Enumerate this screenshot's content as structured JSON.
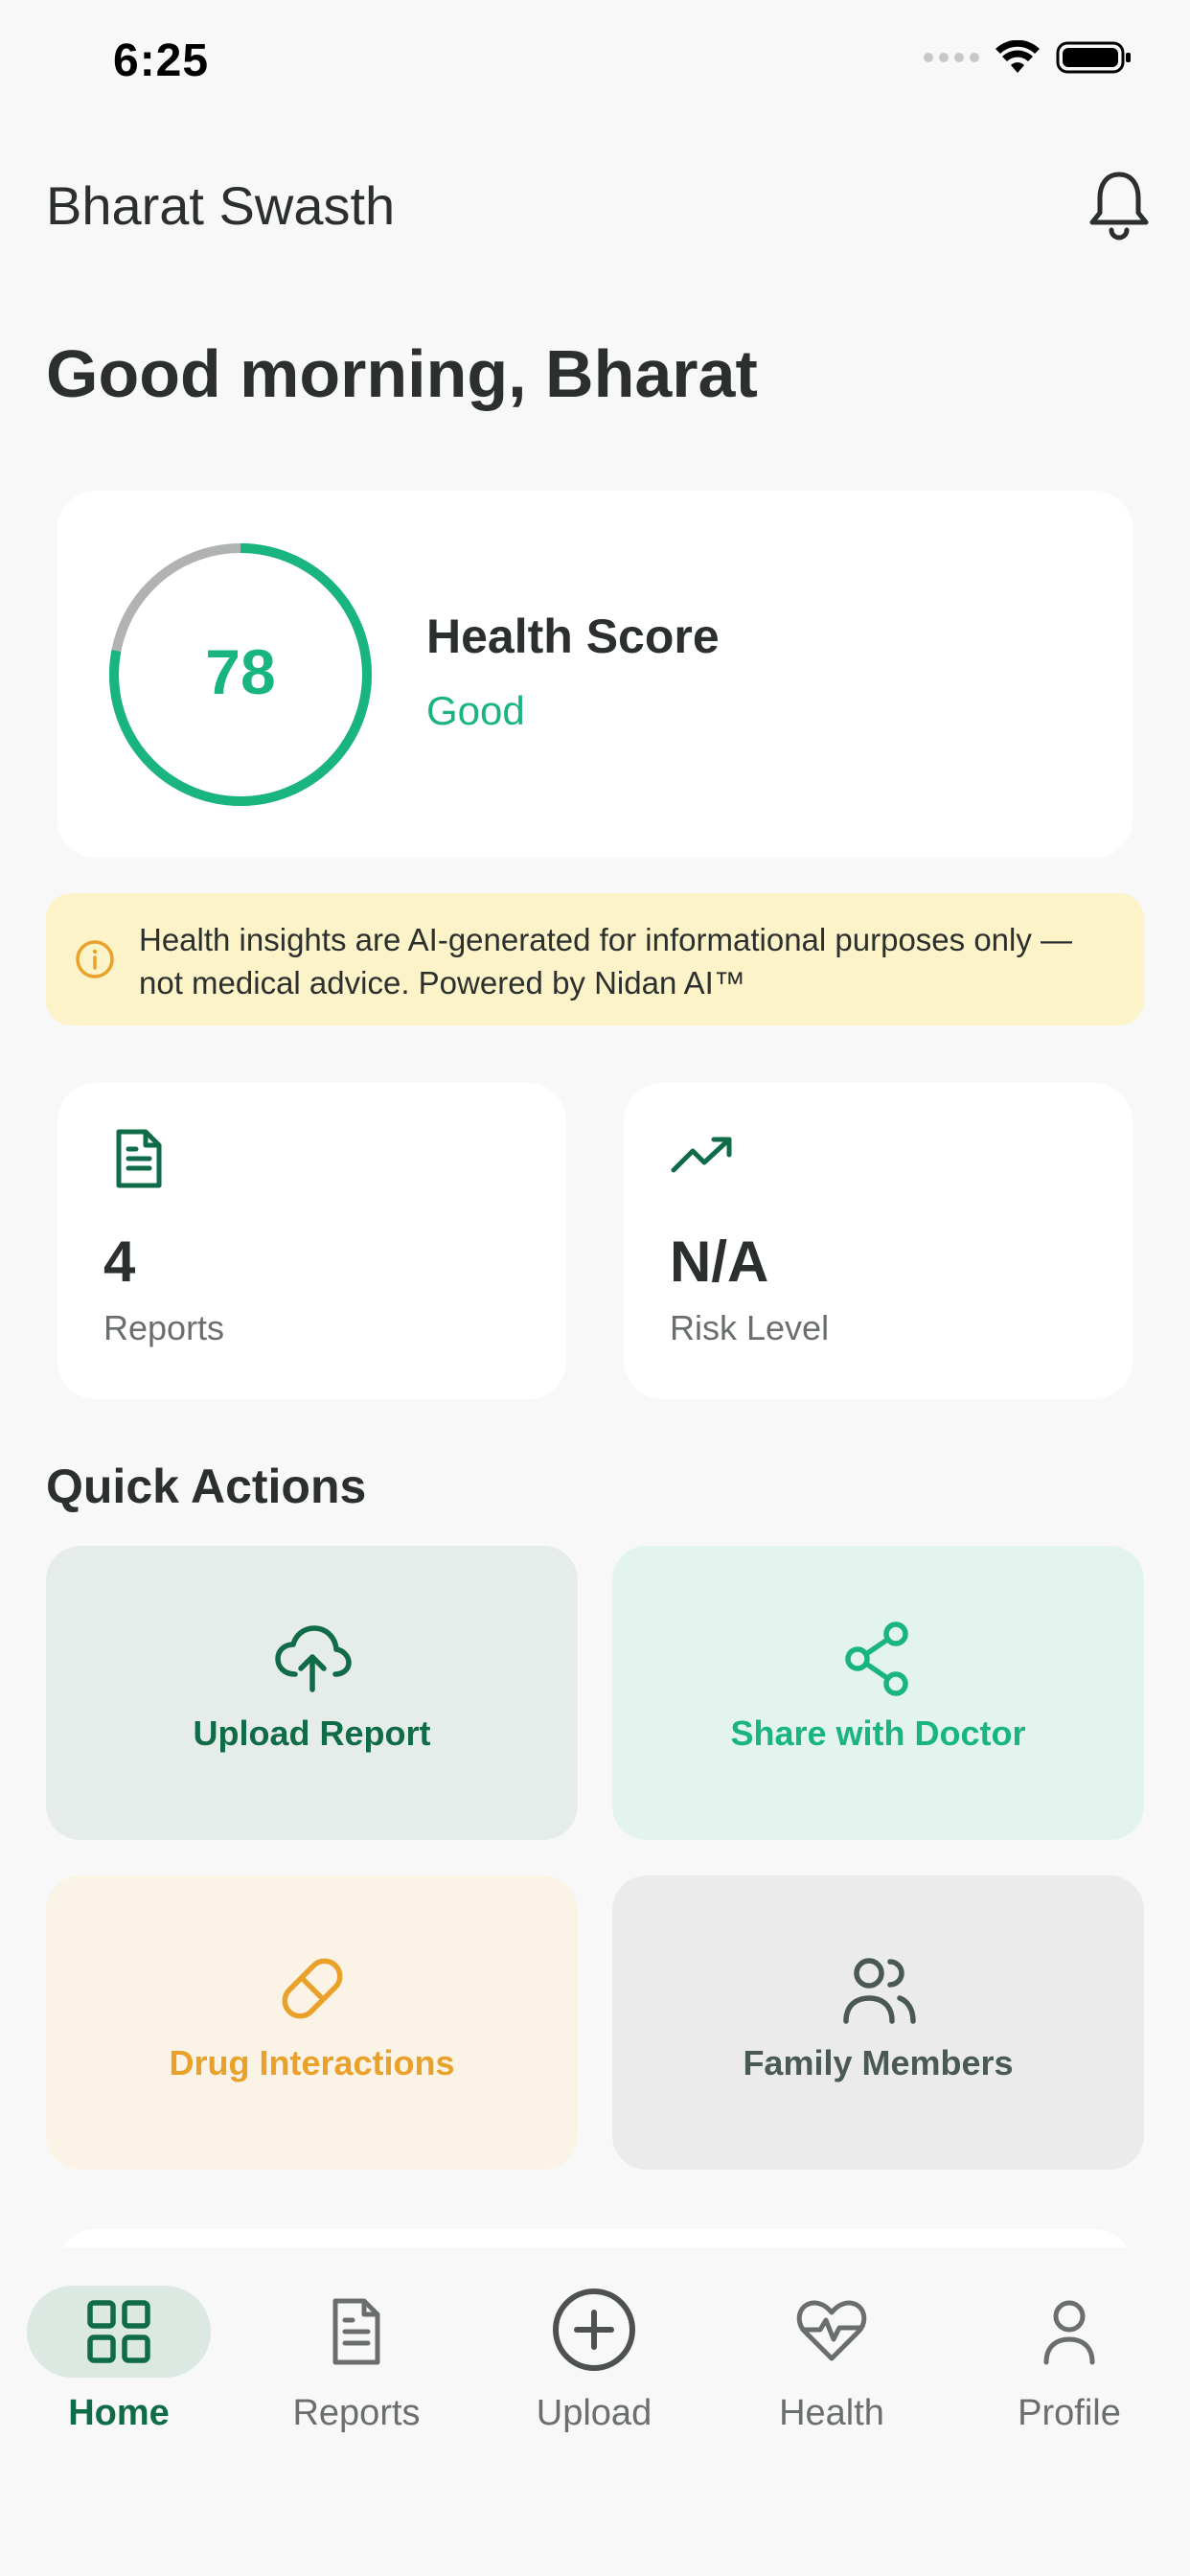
{
  "status_bar": {
    "time": "6:25"
  },
  "header": {
    "app_title": "Bharat Swasth"
  },
  "greeting": "Good morning, Bharat",
  "health_score": {
    "value": "78",
    "fraction": 0.78,
    "label": "Health Score",
    "status": "Good"
  },
  "disclaimer": {
    "text": "Health insights are AI-generated for informational purposes only — not medical advice. Powered by Nidan AI™"
  },
  "stats": [
    {
      "icon": "document-icon",
      "value": "4",
      "label": "Reports"
    },
    {
      "icon": "trending-up-icon",
      "value": "N/A",
      "label": "Risk Level"
    }
  ],
  "quick_actions": {
    "title": "Quick Actions",
    "items": [
      {
        "label": "Upload Report",
        "icon": "cloud-upload-icon",
        "color": "#0f6b48"
      },
      {
        "label": "Share with Doctor",
        "icon": "share-icon",
        "color": "#19b57f"
      },
      {
        "label": "Drug Interactions",
        "icon": "pill-icon",
        "color": "#e9a12a"
      },
      {
        "label": "Family Members",
        "icon": "users-icon",
        "color": "#4a5a52"
      }
    ]
  },
  "bottom_nav": {
    "items": [
      {
        "label": "Home",
        "icon": "grid-icon",
        "active": true
      },
      {
        "label": "Reports",
        "icon": "document-icon",
        "active": false
      },
      {
        "label": "Upload",
        "icon": "plus-circle-icon",
        "active": false
      },
      {
        "label": "Health",
        "icon": "heart-pulse-icon",
        "active": false
      },
      {
        "label": "Profile",
        "icon": "user-icon",
        "active": false
      }
    ]
  },
  "colors": {
    "brand_green": "#19b57f",
    "dark_green": "#0f6b48",
    "amber": "#e9a12a",
    "disclaimer_bg": "#fdf3c8"
  }
}
